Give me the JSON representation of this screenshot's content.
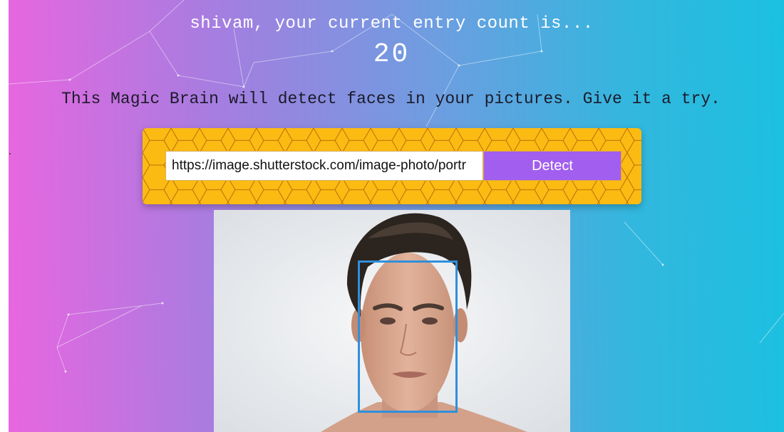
{
  "greeting": {
    "text": "shivam, your current entry count is..."
  },
  "entry_count": "20",
  "tagline": "This Magic Brain will detect faces in your pictures. Give it a try.",
  "image_form": {
    "url_value": "https://image.shutterstock.com/image-photo/portr",
    "detect_label": "Detect"
  },
  "result": {
    "image_subject": "portrait of a man",
    "face_box_color": "#2f8fdc"
  },
  "colors": {
    "gradient_left": "#e866e0",
    "gradient_right": "#1bc0e0",
    "form_panel": "#fbbb12",
    "detect_button": "#a25eee"
  }
}
